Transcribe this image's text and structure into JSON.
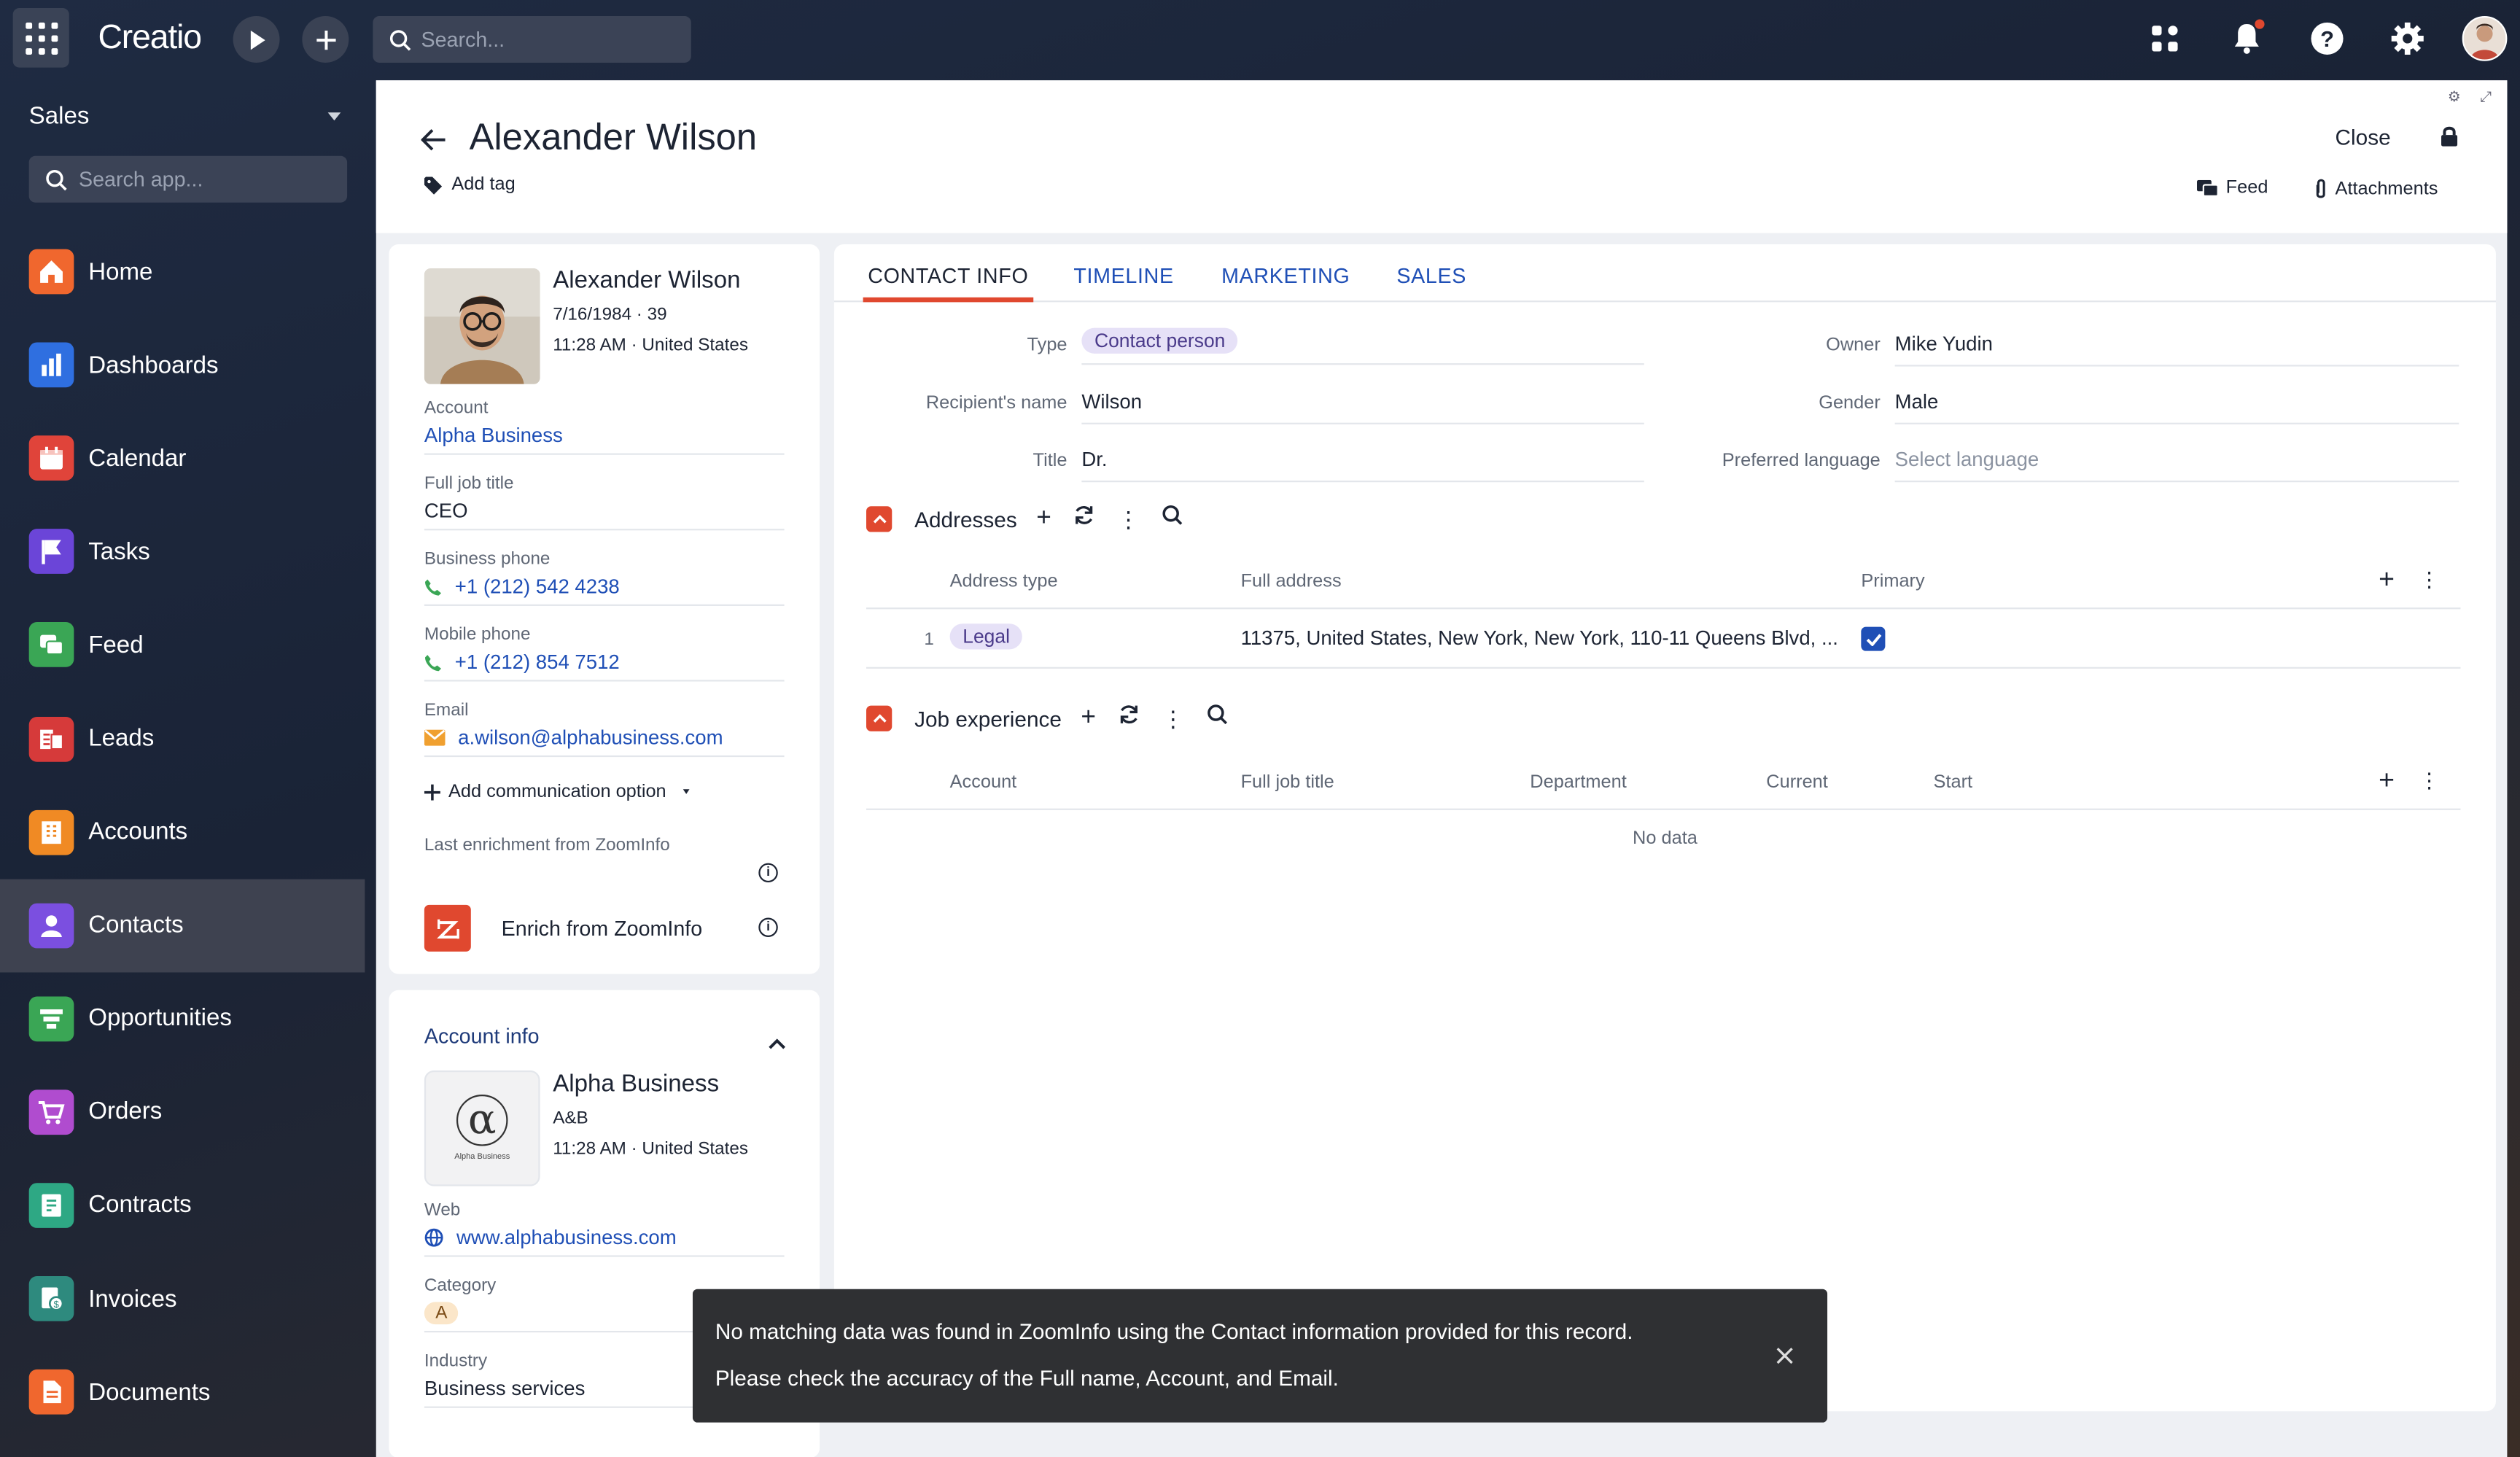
{
  "topbar": {
    "logo": "Creatio",
    "search_placeholder": "Search..."
  },
  "sidebar": {
    "workspace": "Sales",
    "search_placeholder": "Search app...",
    "items": [
      {
        "label": "Home",
        "icon": "home-icon",
        "color": "#f0672e"
      },
      {
        "label": "Dashboards",
        "icon": "bar-chart-icon",
        "color": "#2f6fe0"
      },
      {
        "label": "Calendar",
        "icon": "calendar-icon",
        "color": "#e0443a"
      },
      {
        "label": "Tasks",
        "icon": "flag-icon",
        "color": "#6b45d8"
      },
      {
        "label": "Feed",
        "icon": "chat-icon",
        "color": "#3aa655"
      },
      {
        "label": "Leads",
        "icon": "leads-icon",
        "color": "#d63a3a"
      },
      {
        "label": "Accounts",
        "icon": "building-icon",
        "color": "#f08a24"
      },
      {
        "label": "Contacts",
        "icon": "person-icon",
        "color": "#7b4fe0"
      },
      {
        "label": "Opportunities",
        "icon": "funnel-icon",
        "color": "#3aa655"
      },
      {
        "label": "Orders",
        "icon": "cart-icon",
        "color": "#b04ccf"
      },
      {
        "label": "Contracts",
        "icon": "contract-icon",
        "color": "#2ea884"
      },
      {
        "label": "Invoices",
        "icon": "invoice-icon",
        "color": "#2e8a7e"
      },
      {
        "label": "Documents",
        "icon": "document-icon",
        "color": "#f0672e"
      }
    ],
    "active": "Contacts"
  },
  "header": {
    "title": "Alexander Wilson",
    "add_tag": "Add tag",
    "close": "Close",
    "feed": "Feed",
    "attachments": "Attachments"
  },
  "profile": {
    "name": "Alexander Wilson",
    "dob_age": "7/16/1984 · 39",
    "time_location": "11:28 AM · United States",
    "account_label": "Account",
    "account": "Alpha Business",
    "job_title_label": "Full job title",
    "job_title": "CEO",
    "business_phone_label": "Business phone",
    "business_phone": "+1 (212) 542 4238",
    "mobile_phone_label": "Mobile phone",
    "mobile_phone": "+1 (212) 854 7512",
    "email_label": "Email",
    "email": "a.wilson@alphabusiness.com",
    "add_comm": "Add communication option",
    "last_enrichment": "Last enrichment from ZoomInfo",
    "enrich": "Enrich from ZoomInfo"
  },
  "account_info": {
    "title": "Account info",
    "name": "Alpha Business",
    "code": "A&B",
    "time_location": "11:28 AM · United States",
    "logo_caption": "Alpha Business",
    "web_label": "Web",
    "web": "www.alphabusiness.com",
    "category_label": "Category",
    "category": "A",
    "industry_label": "Industry",
    "industry": "Business services"
  },
  "tabs": [
    "CONTACT INFO",
    "TIMELINE",
    "MARKETING",
    "SALES"
  ],
  "contact_info": {
    "type_label": "Type",
    "type": "Contact person",
    "owner_label": "Owner",
    "owner": "Mike Yudin",
    "recipient_label": "Recipient's name",
    "recipient": "Wilson",
    "gender_label": "Gender",
    "gender": "Male",
    "title_label": "Title",
    "title": "Dr.",
    "language_label": "Preferred language",
    "language_placeholder": "Select language"
  },
  "addresses": {
    "title": "Addresses",
    "columns": [
      "Address type",
      "Full address",
      "Primary"
    ],
    "rows": [
      {
        "num": "1",
        "type": "Legal",
        "address": "11375, United States, New York, New York, 110-11 Queens Blvd, ...",
        "primary": true
      }
    ]
  },
  "job_experience": {
    "title": "Job experience",
    "columns": [
      "Account",
      "Full job title",
      "Department",
      "Current",
      "Start"
    ],
    "empty": "No data"
  },
  "toast": {
    "line1": "No matching data was found in ZoomInfo using the Contact information provided for this record.",
    "line2": "Please check the accuracy of the Full name, Account, and Email."
  }
}
